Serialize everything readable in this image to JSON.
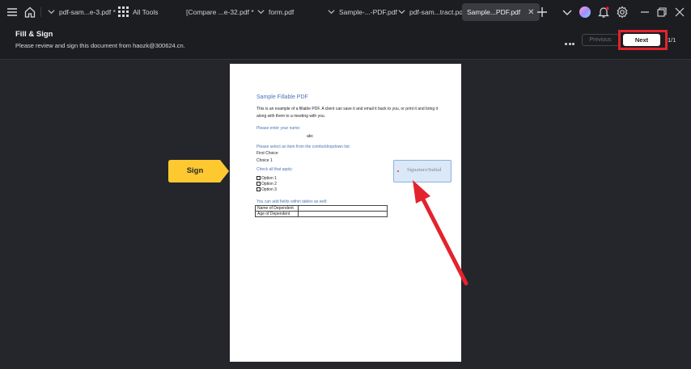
{
  "tabbar": {
    "tools_label": "All Tools",
    "tabs": [
      {
        "label": "pdf-sam...e-3.pdf *"
      },
      {
        "label": "[Compare ...e-32.pdf *"
      },
      {
        "label": "form.pdf"
      },
      {
        "label": "Sample-...-PDF.pdf"
      },
      {
        "label": "pdf-sam...tract.pdf"
      },
      {
        "label": "Sample...PDF.pdf",
        "active": true
      }
    ]
  },
  "header": {
    "title": "Fill & Sign",
    "subtitle": "Please review and sign this document from haozk@300624.cn.",
    "previous_label": "Previous",
    "next_label": "Next",
    "page_count": "1/1"
  },
  "sign_tag": {
    "label": "Sign",
    "color": "#fdc830"
  },
  "document": {
    "title": "Sample Fillable PDF",
    "intro": "This is an example of a fillable PDF. A client can save it and email it back to you, or print it and bring it along with them to a meeting with you.",
    "name_prompt": "Please enter your name:",
    "name_value": "abc",
    "select_prompt": "Please select an item from the combo/dropdown list:",
    "first_choice": "First Choice",
    "choice_value": "Choice 1",
    "check_prompt": "Check all that apply:",
    "options": [
      "Option 1",
      "Option 2",
      "Option 3"
    ],
    "table_prompt": "You can add  fields within tables as well:",
    "table_rows": [
      "Name of Dependent",
      "Age of Dependent"
    ],
    "signature_label": "Signature/Initial"
  },
  "colors": {
    "accent_red": "#e3232d",
    "link_blue": "#4a74b5"
  }
}
